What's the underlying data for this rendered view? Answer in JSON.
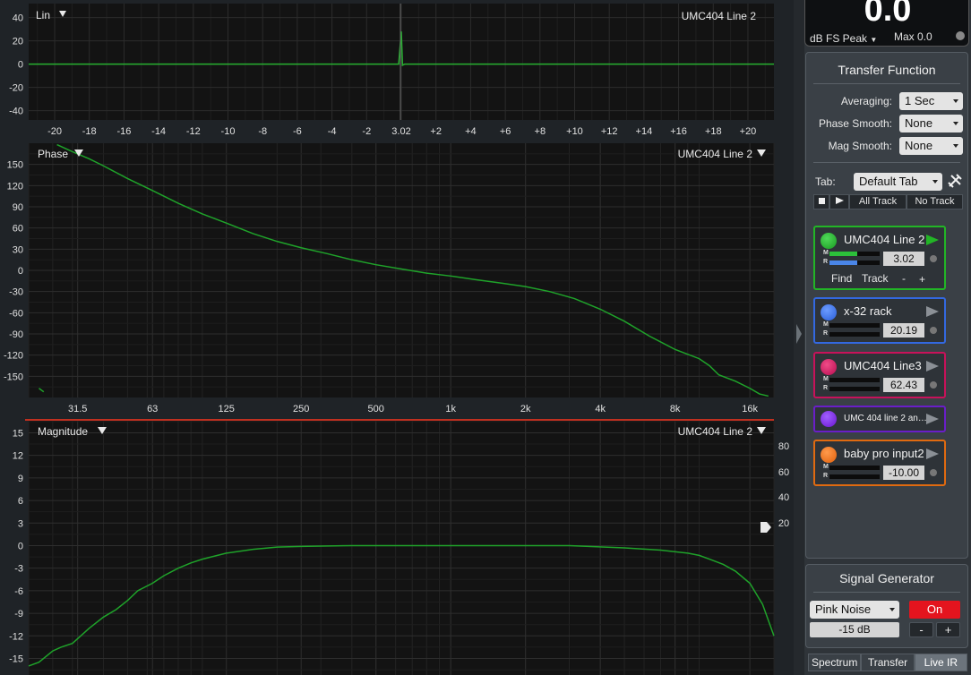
{
  "meter": {
    "value": "0.0",
    "unit": "dB FS Peak",
    "max": "Max 0.0"
  },
  "transfer": {
    "title": "Transfer Function",
    "averaging_label": "Averaging:",
    "averaging_value": "1 Sec",
    "phase_smooth_label": "Phase Smooth:",
    "phase_smooth_value": "None",
    "mag_smooth_label": "Mag Smooth:",
    "mag_smooth_value": "None",
    "tab_label": "Tab:",
    "tab_value": "Default Tab",
    "all_track": "All Track",
    "no_track": "No Track"
  },
  "measurements": [
    {
      "name": "UMC404 Line 2",
      "delay": "3.02",
      "color": "#1faa2a",
      "border": "#22b526",
      "find": "Find",
      "track": "Track",
      "minus": "-",
      "plus": "+",
      "m_level": 0.55,
      "r_level": 0.55
    },
    {
      "name": "x-32 rack",
      "delay": "20.19",
      "color": "#2f6cf0",
      "border": "#3368e0"
    },
    {
      "name": "UMC404 Line3",
      "delay": "62.43",
      "color": "#d41460",
      "border": "#c8125a"
    },
    {
      "name": "UMC 404 line 2 an…",
      "color": "#7a1ee0",
      "border": "#6a1ec8"
    },
    {
      "name": "baby pro input2",
      "delay": "-10.00",
      "color": "#f07014",
      "border": "#e06a10"
    }
  ],
  "signal": {
    "title": "Signal Generator",
    "type": "Pink Noise",
    "level": "-15 dB",
    "on": "On",
    "minus": "-",
    "plus": "+"
  },
  "tabs": [
    "Spectrum",
    "Transfer",
    "Live IR"
  ],
  "colors": {
    "trace": "#1fa32a",
    "impulse": "#27b030",
    "bg": "#131313"
  },
  "chart_data": [
    {
      "type": "line",
      "title": "Lin",
      "legend": "UMC404 Line 2",
      "x_ticks": [
        "-20",
        "-18",
        "-16",
        "-14",
        "-12",
        "-10",
        "-8",
        "-6",
        "-4",
        "-2",
        "3.02",
        "+2",
        "+4",
        "+6",
        "+8",
        "+10",
        "+12",
        "+14",
        "+16",
        "+18",
        "+20"
      ],
      "y_ticks": [
        "40",
        "20",
        "0",
        "-20",
        "-40"
      ],
      "xlim": [
        -21.5,
        21.5
      ],
      "ylim": [
        -48,
        52
      ],
      "series": [
        {
          "x": [
            -21.5,
            -0.15,
            0,
            0.07,
            0.2,
            21.5
          ],
          "y": [
            0,
            0,
            28,
            -1,
            0,
            0
          ]
        }
      ]
    },
    {
      "type": "line",
      "title": "Phase",
      "legend": "UMC404 Line 2",
      "x_ticks": [
        "31.5",
        "63",
        "125",
        "250",
        "500",
        "1k",
        "2k",
        "4k",
        "8k",
        "16k"
      ],
      "y_ticks": [
        "150",
        "120",
        "90",
        "60",
        "30",
        "0",
        "-30",
        "-60",
        "-90",
        "-120",
        "-150"
      ],
      "ylim": [
        -180,
        180
      ],
      "xlim": [
        20,
        20000
      ],
      "series": [
        {
          "x": [
            22,
            23,
            26,
            30,
            35,
            40,
            50,
            63,
            80,
            100,
            125,
            160,
            200,
            250,
            315,
            400,
            500,
            630,
            800,
            1000,
            1250,
            1600,
            2000,
            2500,
            3150,
            4000,
            5000,
            6300,
            8000,
            10000,
            11000,
            12000,
            14000,
            16000,
            17500,
            19000
          ],
          "y": [
            -167,
            -172,
            178,
            168,
            158,
            148,
            130,
            113,
            95,
            80,
            67,
            52,
            41,
            32,
            24,
            15,
            8,
            2,
            -4,
            -8,
            -13,
            -18,
            -23,
            -30,
            -40,
            -55,
            -72,
            -93,
            -112,
            -125,
            -135,
            -148,
            -157,
            -167,
            -175,
            -178
          ]
        }
      ]
    },
    {
      "type": "line",
      "title": "Magnitude",
      "legend": "UMC404 Line 2",
      "x_ticks": [],
      "y_ticks": [
        "15",
        "12",
        "9",
        "6",
        "3",
        "0",
        "-3",
        "-6",
        "-9",
        "-12",
        "-15"
      ],
      "y2_ticks": [
        "80",
        "60",
        "40",
        "20"
      ],
      "ylim": [
        -17.2,
        16.6
      ],
      "xlim": [
        20,
        20000
      ],
      "series": [
        {
          "x": [
            20,
            22,
            25,
            27,
            30,
            35,
            40,
            45,
            50,
            55,
            63,
            70,
            80,
            90,
            100,
            125,
            160,
            200,
            250,
            400,
            1000,
            3000,
            5000,
            7000,
            9000,
            10000,
            11000,
            12500,
            14000,
            16000,
            18000,
            20000
          ],
          "y": [
            -16,
            -15.5,
            -14,
            -13.5,
            -13,
            -11,
            -9.5,
            -8.5,
            -7.3,
            -6,
            -5,
            -4,
            -3,
            -2.3,
            -1.8,
            -1,
            -0.5,
            -0.2,
            -0.1,
            0,
            0,
            0,
            -0.3,
            -0.6,
            -1,
            -1.3,
            -1.8,
            -2.5,
            -3.4,
            -5,
            -7.8,
            -12
          ]
        }
      ]
    }
  ]
}
